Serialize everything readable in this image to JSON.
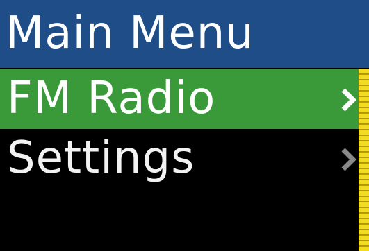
{
  "header": {
    "title": "Main Menu"
  },
  "menu": {
    "items": [
      {
        "label": "FM Radio",
        "selected": true,
        "icon": "chevron-right-icon"
      },
      {
        "label": "Settings",
        "selected": false,
        "icon": "chevron-right-icon"
      }
    ]
  },
  "scrollbar": {
    "position": 0,
    "visible_fraction": 1.0
  },
  "colors": {
    "header_bg": "#1f4d87",
    "selected_bg": "#3a9a3a",
    "background": "#000000",
    "text": "#ffffff",
    "scroll_thumb": "#f3dc20",
    "chevron_selected": "#ffffff",
    "chevron_normal": "#888888"
  }
}
